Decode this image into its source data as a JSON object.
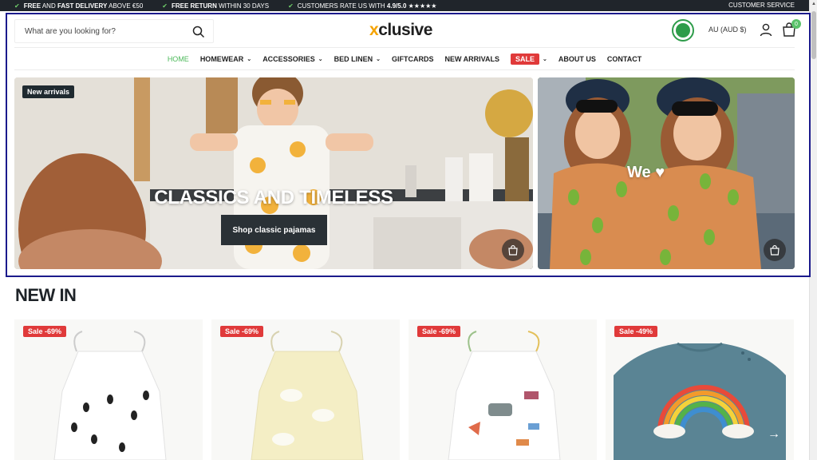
{
  "topbar": {
    "usps": [
      {
        "bold": "FREE",
        "text1": " AND ",
        "bold2": "FAST DELIVERY",
        "text2": " ABOVE €50"
      },
      {
        "bold": "FREE RETURN",
        "text1": " WITHIN 30 DAYS",
        "bold2": "",
        "text2": ""
      },
      {
        "bold": "",
        "text1": "CUSTOMERS RATE US WITH ",
        "bold2": "4.9/5.0",
        "text2": " ★★★★★"
      }
    ],
    "customer_service": "CUSTOMER SERVICE"
  },
  "header": {
    "search_placeholder": "What are you looking for?",
    "logo_x": "x",
    "logo_rest": "clusive",
    "currency": "AU (AUD $)",
    "cart_count": "0"
  },
  "nav": {
    "items": [
      {
        "label": "HOME"
      },
      {
        "label": "HOMEWEAR"
      },
      {
        "label": "ACCESSORIES"
      },
      {
        "label": "BED LINEN"
      },
      {
        "label": "GIFTCARDS"
      },
      {
        "label": "NEW ARRIVALS"
      },
      {
        "label": "SALE"
      },
      {
        "label": "ABOUT US"
      },
      {
        "label": "CONTACT"
      }
    ]
  },
  "hero": {
    "left": {
      "badge": "New arrivals",
      "title": "CLASSICS AND TIMELESS",
      "button": "Shop classic pajamas"
    },
    "right": {
      "title": "We ♥"
    }
  },
  "new_in": {
    "title": "NEW IN",
    "products": [
      {
        "sale": "Sale -69%"
      },
      {
        "sale": "Sale -69%"
      },
      {
        "sale": "Sale -69%"
      },
      {
        "sale": "Sale -49%"
      }
    ]
  },
  "colors": {
    "accent_green": "#4cb95a",
    "sale_red": "#e03a3a",
    "topbar_bg": "#20252b",
    "logo_orange": "#f5a300"
  }
}
